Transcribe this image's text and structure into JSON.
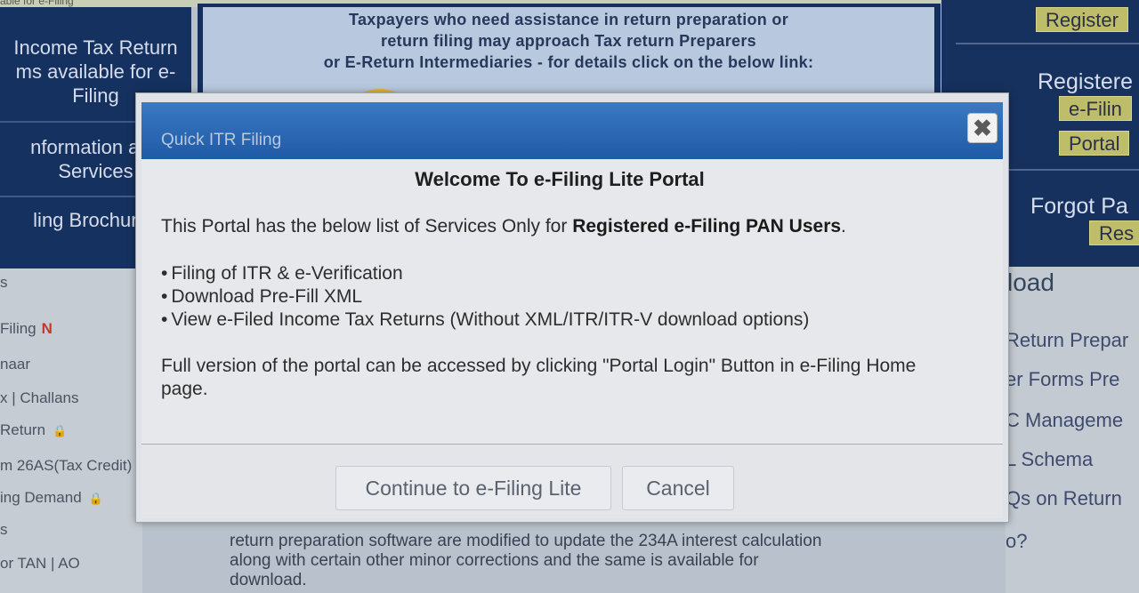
{
  "top_strip": {
    "text": "able for e-Filing"
  },
  "left_nav": {
    "blocks": [
      {
        "lines": [
          "Income Tax Return",
          "ms available for e-",
          "Filing"
        ]
      },
      {
        "lines": [
          "nformation and",
          "Services"
        ]
      },
      {
        "lines": [
          "ling Brochures"
        ]
      }
    ]
  },
  "left_list": {
    "items": [
      {
        "label": "s"
      },
      {
        "label": "Filing",
        "badge": "N"
      },
      {
        "label": "naar"
      },
      {
        "label": "x | Challans"
      },
      {
        "label": "Return",
        "lock": true
      },
      {
        "label": "m 26AS(Tax Credit)"
      },
      {
        "label": "ing Demand",
        "lock": true
      },
      {
        "label": "s"
      },
      {
        "label": "or TAN | AO"
      }
    ]
  },
  "banner": {
    "line1": "Taxpayers who need assistance in return preparation or",
    "line2": "return filing may approach Tax return Preparers",
    "line3": "or E-Return Intermediaries - for details click on the below link:"
  },
  "right_panel": {
    "register_btn": "Register",
    "registered_label": "Registere",
    "efiling_btn": "e-Filin",
    "portal_btn": "Portal",
    "forgot_label": "Forgot Pa",
    "reset_btn": "Res"
  },
  "right_list": {
    "title": "load",
    "items": [
      "Return Prepar",
      "er Forms Pre",
      "C Manageme",
      "L Schema",
      "Qs on Return",
      "o?"
    ]
  },
  "bottom_text": {
    "line1": "return preparation software are modified to update the 234A interest calculation",
    "line2": "along with certain other minor corrections and the same is available for",
    "line3": "download."
  },
  "modal": {
    "title": "Quick ITR Filing",
    "close_symbol": "✖",
    "welcome": "Welcome To e-Filing Lite Portal",
    "intro_prefix": "This Portal has the below list of Services Only for ",
    "intro_bold": "Registered e-Filing PAN Users",
    "intro_suffix": ".",
    "services": [
      "Filing of ITR & e-Verification",
      "Download Pre-Fill XML",
      "View e-Filed Income Tax Returns (Without XML/ITR/ITR-V download options)"
    ],
    "note": "Full version of the portal can be accessed by clicking \"Portal Login\" Button in e-Filing Home page.",
    "continue_label": "Continue to e-Filing Lite",
    "cancel_label": "Cancel"
  }
}
